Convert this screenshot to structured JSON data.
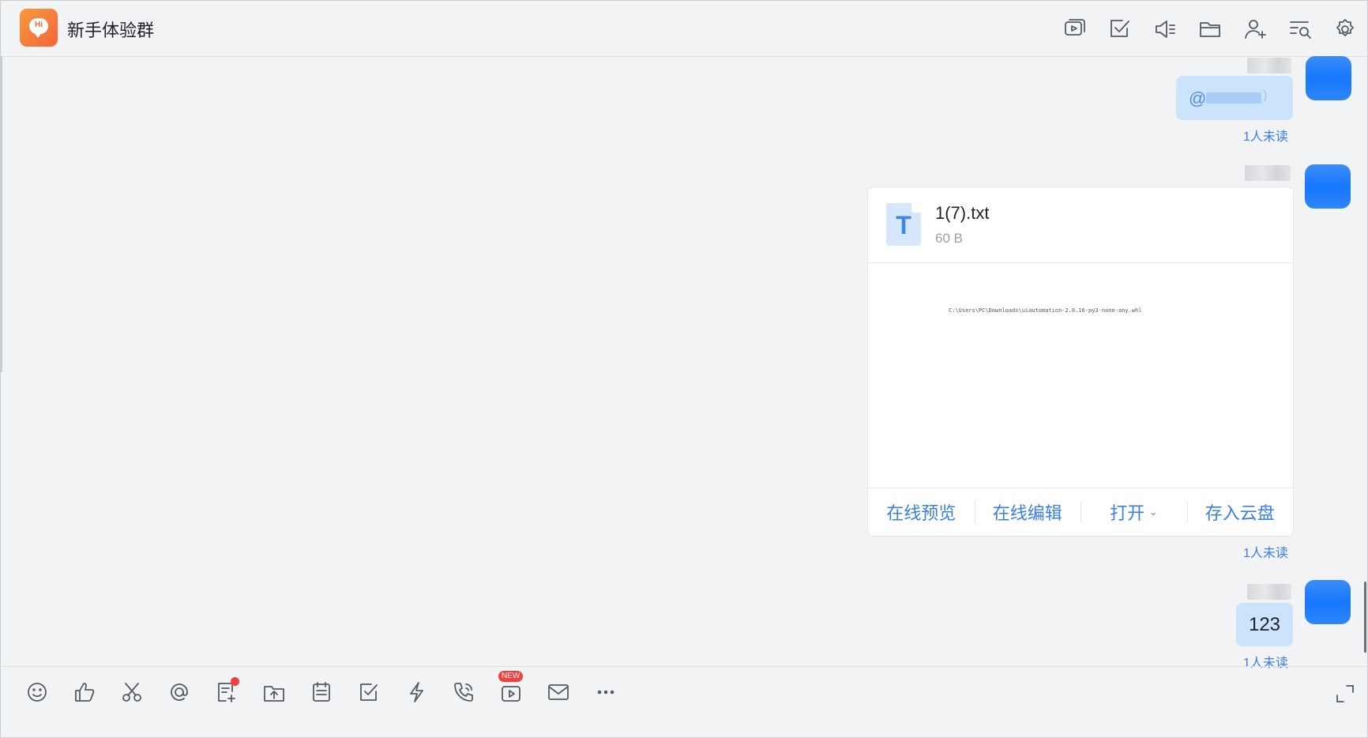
{
  "header": {
    "title": "新手体验群",
    "logo_text": "Hi",
    "icons": [
      "screen-share-icon",
      "task-check-icon",
      "announcement-icon",
      "folder-icon",
      "add-member-icon",
      "search-history-icon",
      "settings-icon"
    ]
  },
  "messages": [
    {
      "type": "mention",
      "prefix": "@",
      "tail": ")",
      "status": "1人未读"
    },
    {
      "type": "file",
      "file_name": "1(7).txt",
      "file_size": "60 B",
      "file_icon_letter": "T",
      "preview": "C:\\Users\\PC\\Downloads\\uiautomation-2.0.16-py3-none-any.whl",
      "actions": {
        "preview": "在线预览",
        "edit": "在线编辑",
        "open": "打开",
        "save": "存入云盘"
      },
      "status": "1人未读"
    },
    {
      "type": "text",
      "text": "123",
      "status": "1人未读"
    }
  ],
  "toolbar": {
    "badge_new": "NEW",
    "icons": [
      "emoji-icon",
      "thumbs-up-icon",
      "screenshot-scissors-icon",
      "mention-icon",
      "note-add-icon",
      "upload-file-icon",
      "calendar-icon",
      "task-icon",
      "quick-reply-icon",
      "phone-call-icon",
      "video-meeting-icon",
      "mail-icon",
      "more-icon"
    ]
  },
  "colors": {
    "accent": "#3a7ee6",
    "bubble": "#cce4fb",
    "avatar": "#1677ff",
    "badge": "#f53f3f"
  }
}
